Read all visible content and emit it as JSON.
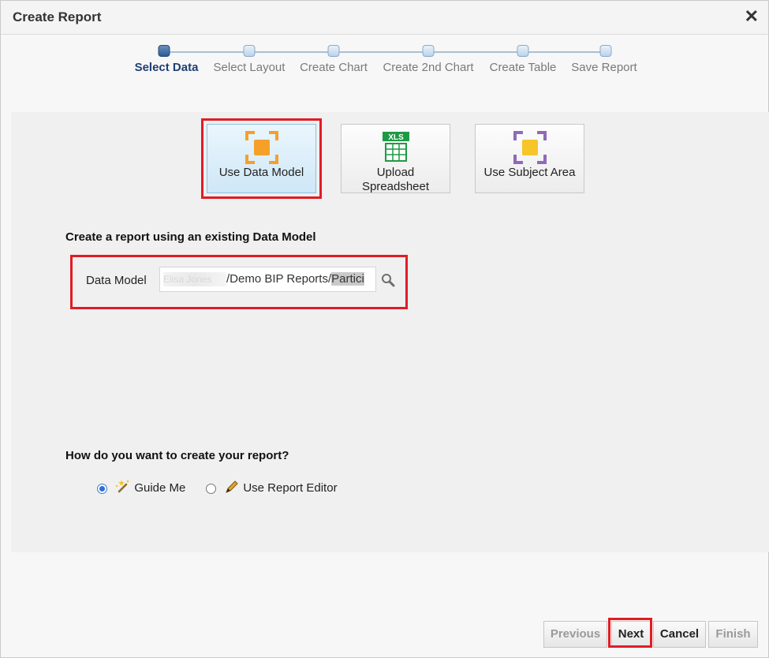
{
  "dialog": {
    "title": "Create Report",
    "close_glyph": "✕"
  },
  "train": {
    "steps": [
      {
        "label": "Select Data",
        "active": true
      },
      {
        "label": "Select Layout",
        "active": false
      },
      {
        "label": "Create Chart",
        "active": false
      },
      {
        "label": "Create 2nd Chart",
        "active": false
      },
      {
        "label": "Create Table",
        "active": false
      },
      {
        "label": "Save Report",
        "active": false
      }
    ]
  },
  "sources": {
    "data_model": {
      "label": "Use Data Model",
      "icon": "data-model-icon",
      "selected": true
    },
    "spreadsheet": {
      "label_line1": "Upload",
      "label_line2": "Spreadsheet",
      "icon": "spreadsheet-icon",
      "badge": "XLS"
    },
    "subject_area": {
      "label": "Use Subject Area",
      "icon": "subject-area-icon"
    }
  },
  "data_model_section": {
    "heading": "Create a report using an existing Data Model",
    "field_label": "Data Model",
    "value_obscured": "Elisa Jones",
    "value_path": "/Demo BIP Reports/",
    "value_selected": "Partici"
  },
  "create_mode": {
    "heading": "How do you want to create your report?",
    "options": [
      {
        "label": "Guide Me",
        "icon": "magic-wand-icon",
        "checked": true
      },
      {
        "label": "Use Report Editor",
        "icon": "pencil-icon",
        "checked": false
      }
    ]
  },
  "footer": {
    "previous": "Previous",
    "next": "Next",
    "cancel": "Cancel",
    "finish": "Finish"
  },
  "colors": {
    "highlight": "#e11c24",
    "accent": "#1f3f73",
    "data_model_orange": "#f5a02a",
    "subject_purple": "#8e6bb8",
    "xls_green": "#1e9a45"
  }
}
